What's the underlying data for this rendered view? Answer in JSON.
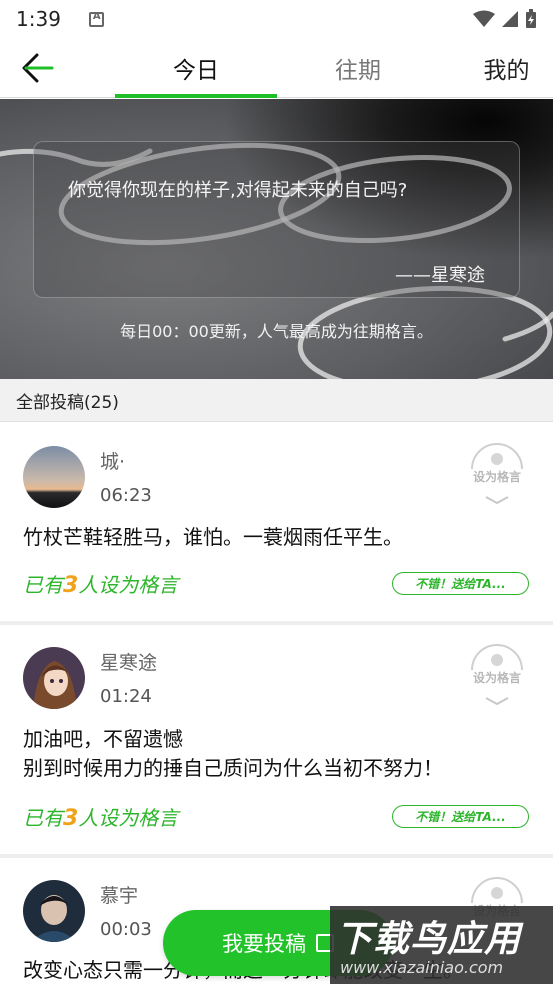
{
  "status_bar": {
    "time": "1:39"
  },
  "tabs": [
    {
      "label": "今日",
      "active": true
    },
    {
      "label": "往期",
      "active": false
    },
    {
      "label": "我的",
      "active": false
    }
  ],
  "banner": {
    "quote": "你觉得你现在的样子,对得起未来的自己吗?",
    "author": "——星寒途",
    "note": "每日00：00更新，人气最高成为往期格言。"
  },
  "section": {
    "title": "全部投稿(25)"
  },
  "posts": [
    {
      "username": "城·",
      "time": "06:23",
      "content": "竹杖芒鞋轻胜马，谁怕。一蓑烟雨任平生。",
      "motto_prefix": "已有",
      "motto_count": "3",
      "motto_suffix": "人设为格言",
      "give_label": "不错！送给TA...",
      "set_motto_label": "设为格言"
    },
    {
      "username": "星寒途",
      "time": "01:24",
      "content": "加油吧，不留遗憾\n别到时候用力的捶自己质问为什么当初不努力！",
      "motto_prefix": "已有",
      "motto_count": "3",
      "motto_suffix": "人设为格言",
      "give_label": "不错！送给TA...",
      "set_motto_label": "设为格言"
    },
    {
      "username": "慕宇",
      "time": "00:03",
      "content": "改变心态只需一分钟，而这一分钟却能改变一生。",
      "set_motto_label": "设为格言"
    }
  ],
  "submit": {
    "label": "我要投稿"
  },
  "watermark": {
    "title": "下载鸟应用",
    "url": "www.xiazainiao.com"
  },
  "colors": {
    "accent": "#1fbf2a",
    "count": "#f0a21a",
    "motto_text": "#2db52c"
  }
}
